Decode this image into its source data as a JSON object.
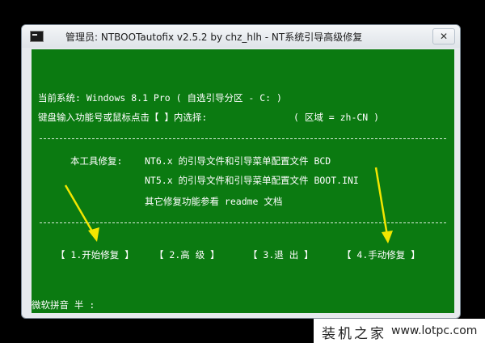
{
  "window": {
    "title": "管理员:  NTBOOTautofix v2.5.2 by chz_hlh - NT系统引导高级修复",
    "close_label": "✕"
  },
  "console": {
    "line1": "当前系统: Windows 8.1 Pro  ( 自选引导分区 - C: )",
    "line2": "键盘输入功能号或鼠标点击【 】内选择:",
    "line2_right": "( 区域 = zh-CN )",
    "repair_label": "本工具修复:",
    "repair_nt6": "NT6.x 的引导文件和引导菜单配置文件 BCD",
    "repair_nt5": "NT5.x 的引导文件和引导菜单配置文件 BOOT.INI",
    "readme": "其它修复功能参看 readme 文档",
    "menu": [
      "【 1.开始修复 】",
      "【 2.高  级 】",
      "【 3.退  出 】",
      "【 4.手动修复 】"
    ],
    "ime": "微软拼音 半 :"
  },
  "watermark": {
    "brand": "装机之家",
    "url": "www.lotpc.com"
  },
  "colors": {
    "console_bg": "#0b7a11",
    "arrow": "#f2e600"
  }
}
